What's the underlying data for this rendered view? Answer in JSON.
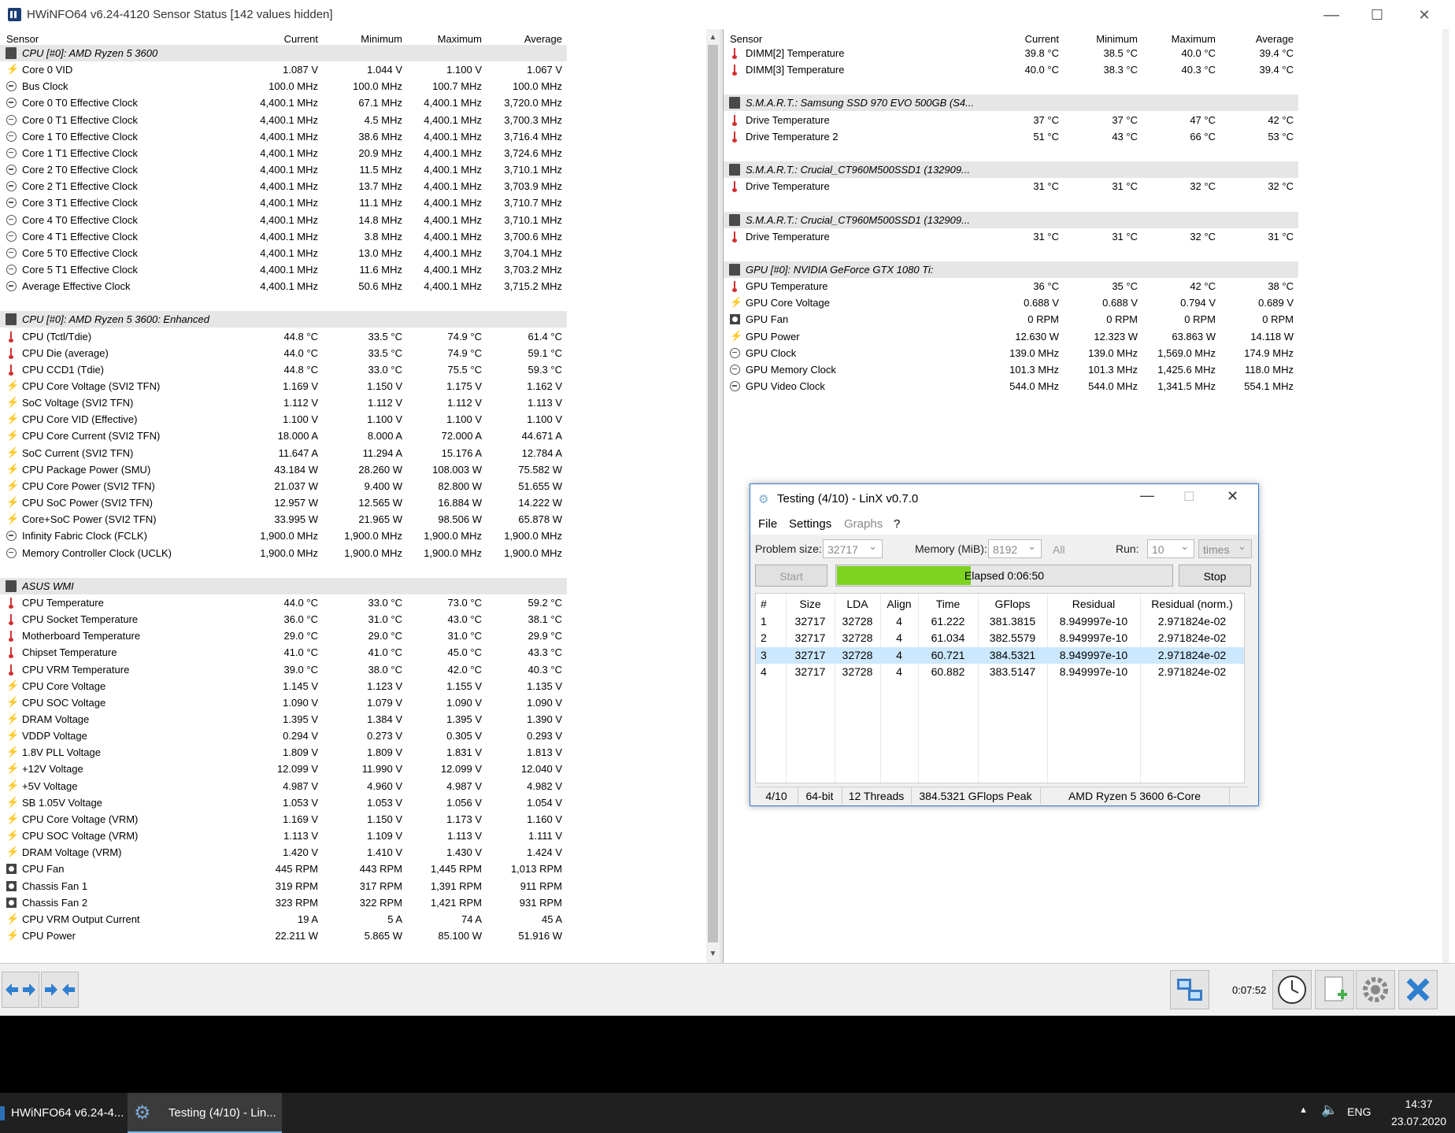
{
  "window": {
    "title": "HWiNFO64 v6.24-4120 Sensor Status [142 values hidden]",
    "min_glyph": "—",
    "max_glyph": "☐",
    "close_glyph": "✕"
  },
  "columns": {
    "sensor": "Sensor",
    "current": "Current",
    "minimum": "Minimum",
    "maximum": "Maximum",
    "average": "Average"
  },
  "left_rows": [
    {
      "type": "group",
      "label": "CPU [#0]: AMD Ryzen 5 3600"
    },
    {
      "type": "row",
      "icon": "volt",
      "label": "Core 0 VID",
      "cur": "1.087 V",
      "min": "1.044 V",
      "max": "1.100 V",
      "avg": "1.067 V"
    },
    {
      "type": "row",
      "icon": "clock",
      "label": "Bus Clock",
      "cur": "100.0 MHz",
      "min": "100.0 MHz",
      "max": "100.7 MHz",
      "avg": "100.0 MHz"
    },
    {
      "type": "row",
      "icon": "clock",
      "label": "Core 0 T0 Effective Clock",
      "cur": "4,400.1 MHz",
      "min": "67.1 MHz",
      "max": "4,400.1 MHz",
      "avg": "3,720.0 MHz"
    },
    {
      "type": "row",
      "icon": "clock",
      "label": "Core 0 T1 Effective Clock",
      "cur": "4,400.1 MHz",
      "min": "4.5 MHz",
      "max": "4,400.1 MHz",
      "avg": "3,700.3 MHz"
    },
    {
      "type": "row",
      "icon": "clock",
      "label": "Core 1 T0 Effective Clock",
      "cur": "4,400.1 MHz",
      "min": "38.6 MHz",
      "max": "4,400.1 MHz",
      "avg": "3,716.4 MHz"
    },
    {
      "type": "row",
      "icon": "clock",
      "label": "Core 1 T1 Effective Clock",
      "cur": "4,400.1 MHz",
      "min": "20.9 MHz",
      "max": "4,400.1 MHz",
      "avg": "3,724.6 MHz"
    },
    {
      "type": "row",
      "icon": "clock",
      "label": "Core 2 T0 Effective Clock",
      "cur": "4,400.1 MHz",
      "min": "11.5 MHz",
      "max": "4,400.1 MHz",
      "avg": "3,710.1 MHz"
    },
    {
      "type": "row",
      "icon": "clock",
      "label": "Core 2 T1 Effective Clock",
      "cur": "4,400.1 MHz",
      "min": "13.7 MHz",
      "max": "4,400.1 MHz",
      "avg": "3,703.9 MHz"
    },
    {
      "type": "row",
      "icon": "clock",
      "label": "Core 3 T1 Effective Clock",
      "cur": "4,400.1 MHz",
      "min": "11.1 MHz",
      "max": "4,400.1 MHz",
      "avg": "3,710.7 MHz"
    },
    {
      "type": "row",
      "icon": "clock",
      "label": "Core 4 T0 Effective Clock",
      "cur": "4,400.1 MHz",
      "min": "14.8 MHz",
      "max": "4,400.1 MHz",
      "avg": "3,710.1 MHz"
    },
    {
      "type": "row",
      "icon": "clock",
      "label": "Core 4 T1 Effective Clock",
      "cur": "4,400.1 MHz",
      "min": "3.8 MHz",
      "max": "4,400.1 MHz",
      "avg": "3,700.6 MHz"
    },
    {
      "type": "row",
      "icon": "clock",
      "label": "Core 5 T0 Effective Clock",
      "cur": "4,400.1 MHz",
      "min": "13.0 MHz",
      "max": "4,400.1 MHz",
      "avg": "3,704.1 MHz"
    },
    {
      "type": "row",
      "icon": "clock",
      "label": "Core 5 T1 Effective Clock",
      "cur": "4,400.1 MHz",
      "min": "11.6 MHz",
      "max": "4,400.1 MHz",
      "avg": "3,703.2 MHz"
    },
    {
      "type": "row",
      "icon": "clock",
      "label": "Average Effective Clock",
      "cur": "4,400.1 MHz",
      "min": "50.6 MHz",
      "max": "4,400.1 MHz",
      "avg": "3,715.2 MHz"
    },
    {
      "type": "blank"
    },
    {
      "type": "group",
      "label": "CPU [#0]: AMD Ryzen 5 3600: Enhanced"
    },
    {
      "type": "row",
      "icon": "temp",
      "label": "CPU (Tctl/Tdie)",
      "cur": "44.8 °C",
      "min": "33.5 °C",
      "max": "74.9 °C",
      "avg": "61.4 °C"
    },
    {
      "type": "row",
      "icon": "temp",
      "label": "CPU Die (average)",
      "cur": "44.0 °C",
      "min": "33.5 °C",
      "max": "74.9 °C",
      "avg": "59.1 °C"
    },
    {
      "type": "row",
      "icon": "temp",
      "label": "CPU CCD1 (Tdie)",
      "cur": "44.8 °C",
      "min": "33.0 °C",
      "max": "75.5 °C",
      "avg": "59.3 °C"
    },
    {
      "type": "row",
      "icon": "volt",
      "label": "CPU Core Voltage (SVI2 TFN)",
      "cur": "1.169 V",
      "min": "1.150 V",
      "max": "1.175 V",
      "avg": "1.162 V"
    },
    {
      "type": "row",
      "icon": "volt",
      "label": "SoC Voltage (SVI2 TFN)",
      "cur": "1.112 V",
      "min": "1.112 V",
      "max": "1.112 V",
      "avg": "1.113 V"
    },
    {
      "type": "row",
      "icon": "volt",
      "label": "CPU Core VID (Effective)",
      "cur": "1.100 V",
      "min": "1.100 V",
      "max": "1.100 V",
      "avg": "1.100 V"
    },
    {
      "type": "row",
      "icon": "volt",
      "label": "CPU Core Current (SVI2 TFN)",
      "cur": "18.000 A",
      "min": "8.000 A",
      "max": "72.000 A",
      "avg": "44.671 A"
    },
    {
      "type": "row",
      "icon": "volt",
      "label": "SoC Current (SVI2 TFN)",
      "cur": "11.647 A",
      "min": "11.294 A",
      "max": "15.176 A",
      "avg": "12.784 A"
    },
    {
      "type": "row",
      "icon": "volt",
      "label": "CPU Package Power (SMU)",
      "cur": "43.184 W",
      "min": "28.260 W",
      "max": "108.003 W",
      "avg": "75.582 W"
    },
    {
      "type": "row",
      "icon": "volt",
      "label": "CPU Core Power (SVI2 TFN)",
      "cur": "21.037 W",
      "min": "9.400 W",
      "max": "82.800 W",
      "avg": "51.655 W"
    },
    {
      "type": "row",
      "icon": "volt",
      "label": "CPU SoC Power (SVI2 TFN)",
      "cur": "12.957 W",
      "min": "12.565 W",
      "max": "16.884 W",
      "avg": "14.222 W"
    },
    {
      "type": "row",
      "icon": "volt",
      "label": "Core+SoC Power (SVI2 TFN)",
      "cur": "33.995 W",
      "min": "21.965 W",
      "max": "98.506 W",
      "avg": "65.878 W"
    },
    {
      "type": "row",
      "icon": "clock",
      "label": "Infinity Fabric Clock (FCLK)",
      "cur": "1,900.0 MHz",
      "min": "1,900.0 MHz",
      "max": "1,900.0 MHz",
      "avg": "1,900.0 MHz"
    },
    {
      "type": "row",
      "icon": "clock",
      "label": "Memory Controller Clock (UCLK)",
      "cur": "1,900.0 MHz",
      "min": "1,900.0 MHz",
      "max": "1,900.0 MHz",
      "avg": "1,900.0 MHz"
    },
    {
      "type": "blank"
    },
    {
      "type": "group",
      "label": "ASUS WMI"
    },
    {
      "type": "row",
      "icon": "temp",
      "label": "CPU Temperature",
      "cur": "44.0 °C",
      "min": "33.0 °C",
      "max": "73.0 °C",
      "avg": "59.2 °C"
    },
    {
      "type": "row",
      "icon": "temp",
      "label": "CPU Socket Temperature",
      "cur": "36.0 °C",
      "min": "31.0 °C",
      "max": "43.0 °C",
      "avg": "38.1 °C"
    },
    {
      "type": "row",
      "icon": "temp",
      "label": "Motherboard Temperature",
      "cur": "29.0 °C",
      "min": "29.0 °C",
      "max": "31.0 °C",
      "avg": "29.9 °C"
    },
    {
      "type": "row",
      "icon": "temp",
      "label": "Chipset Temperature",
      "cur": "41.0 °C",
      "min": "41.0 °C",
      "max": "45.0 °C",
      "avg": "43.3 °C"
    },
    {
      "type": "row",
      "icon": "temp",
      "label": "CPU VRM Temperature",
      "cur": "39.0 °C",
      "min": "38.0 °C",
      "max": "42.0 °C",
      "avg": "40.3 °C"
    },
    {
      "type": "row",
      "icon": "volt",
      "label": "CPU Core Voltage",
      "cur": "1.145 V",
      "min": "1.123 V",
      "max": "1.155 V",
      "avg": "1.135 V"
    },
    {
      "type": "row",
      "icon": "volt",
      "label": "CPU SOC Voltage",
      "cur": "1.090 V",
      "min": "1.079 V",
      "max": "1.090 V",
      "avg": "1.090 V"
    },
    {
      "type": "row",
      "icon": "volt",
      "label": "DRAM Voltage",
      "cur": "1.395 V",
      "min": "1.384 V",
      "max": "1.395 V",
      "avg": "1.390 V"
    },
    {
      "type": "row",
      "icon": "volt",
      "label": "VDDP Voltage",
      "cur": "0.294 V",
      "min": "0.273 V",
      "max": "0.305 V",
      "avg": "0.293 V"
    },
    {
      "type": "row",
      "icon": "volt",
      "label": "1.8V PLL Voltage",
      "cur": "1.809 V",
      "min": "1.809 V",
      "max": "1.831 V",
      "avg": "1.813 V"
    },
    {
      "type": "row",
      "icon": "volt",
      "label": "+12V Voltage",
      "cur": "12.099 V",
      "min": "11.990 V",
      "max": "12.099 V",
      "avg": "12.040 V"
    },
    {
      "type": "row",
      "icon": "volt",
      "label": "+5V Voltage",
      "cur": "4.987 V",
      "min": "4.960 V",
      "max": "4.987 V",
      "avg": "4.982 V"
    },
    {
      "type": "row",
      "icon": "volt",
      "label": "SB 1.05V Voltage",
      "cur": "1.053 V",
      "min": "1.053 V",
      "max": "1.056 V",
      "avg": "1.054 V"
    },
    {
      "type": "row",
      "icon": "volt",
      "label": "CPU Core Voltage (VRM)",
      "cur": "1.169 V",
      "min": "1.150 V",
      "max": "1.173 V",
      "avg": "1.160 V"
    },
    {
      "type": "row",
      "icon": "volt",
      "label": "CPU SOC Voltage (VRM)",
      "cur": "1.113 V",
      "min": "1.109 V",
      "max": "1.113 V",
      "avg": "1.111 V"
    },
    {
      "type": "row",
      "icon": "volt",
      "label": "DRAM Voltage (VRM)",
      "cur": "1.420 V",
      "min": "1.410 V",
      "max": "1.430 V",
      "avg": "1.424 V"
    },
    {
      "type": "row",
      "icon": "fan",
      "label": "CPU Fan",
      "cur": "445 RPM",
      "min": "443 RPM",
      "max": "1,445 RPM",
      "avg": "1,013 RPM"
    },
    {
      "type": "row",
      "icon": "fan",
      "label": "Chassis Fan 1",
      "cur": "319 RPM",
      "min": "317 RPM",
      "max": "1,391 RPM",
      "avg": "911 RPM"
    },
    {
      "type": "row",
      "icon": "fan",
      "label": "Chassis Fan 2",
      "cur": "323 RPM",
      "min": "322 RPM",
      "max": "1,421 RPM",
      "avg": "931 RPM"
    },
    {
      "type": "row",
      "icon": "volt",
      "label": "CPU VRM Output Current",
      "cur": "19 A",
      "min": "5 A",
      "max": "74 A",
      "avg": "45 A"
    },
    {
      "type": "row",
      "icon": "volt",
      "label": "CPU Power",
      "cur": "22.211 W",
      "min": "5.865 W",
      "max": "85.100 W",
      "avg": "51.916 W"
    }
  ],
  "right_rows": [
    {
      "type": "row",
      "icon": "temp",
      "label": "DIMM[2] Temperature",
      "cur": "39.8 °C",
      "min": "38.5 °C",
      "max": "40.0 °C",
      "avg": "39.4 °C"
    },
    {
      "type": "row",
      "icon": "temp",
      "label": "DIMM[3] Temperature",
      "cur": "40.0 °C",
      "min": "38.3 °C",
      "max": "40.3 °C",
      "avg": "39.4 °C"
    },
    {
      "type": "blank"
    },
    {
      "type": "group",
      "label": "S.M.A.R.T.: Samsung SSD 970 EVO 500GB (S4..."
    },
    {
      "type": "row",
      "icon": "temp",
      "label": "Drive Temperature",
      "cur": "37 °C",
      "min": "37 °C",
      "max": "47 °C",
      "avg": "42 °C"
    },
    {
      "type": "row",
      "icon": "temp",
      "label": "Drive Temperature 2",
      "cur": "51 °C",
      "min": "43 °C",
      "max": "66 °C",
      "avg": "53 °C"
    },
    {
      "type": "blank"
    },
    {
      "type": "group",
      "label": "S.M.A.R.T.: Crucial_CT960M500SSD1 (132909..."
    },
    {
      "type": "row",
      "icon": "temp",
      "label": "Drive Temperature",
      "cur": "31 °C",
      "min": "31 °C",
      "max": "32 °C",
      "avg": "32 °C"
    },
    {
      "type": "blank"
    },
    {
      "type": "group",
      "label": "S.M.A.R.T.: Crucial_CT960M500SSD1 (132909..."
    },
    {
      "type": "row",
      "icon": "temp",
      "label": "Drive Temperature",
      "cur": "31 °C",
      "min": "31 °C",
      "max": "32 °C",
      "avg": "31 °C"
    },
    {
      "type": "blank"
    },
    {
      "type": "group",
      "label": "GPU [#0]: NVIDIA GeForce GTX 1080 Ti:"
    },
    {
      "type": "row",
      "icon": "temp",
      "label": "GPU Temperature",
      "cur": "36 °C",
      "min": "35 °C",
      "max": "42 °C",
      "avg": "38 °C"
    },
    {
      "type": "row",
      "icon": "volt",
      "label": "GPU Core Voltage",
      "cur": "0.688 V",
      "min": "0.688 V",
      "max": "0.794 V",
      "avg": "0.689 V"
    },
    {
      "type": "row",
      "icon": "fan",
      "label": "GPU Fan",
      "cur": "0 RPM",
      "min": "0 RPM",
      "max": "0 RPM",
      "avg": "0 RPM"
    },
    {
      "type": "row",
      "icon": "volt",
      "label": "GPU Power",
      "cur": "12.630 W",
      "min": "12.323 W",
      "max": "63.863 W",
      "avg": "14.118 W"
    },
    {
      "type": "row",
      "icon": "clock",
      "label": "GPU Clock",
      "cur": "139.0 MHz",
      "min": "139.0 MHz",
      "max": "1,569.0 MHz",
      "avg": "174.9 MHz"
    },
    {
      "type": "row",
      "icon": "clock",
      "label": "GPU Memory Clock",
      "cur": "101.3 MHz",
      "min": "101.3 MHz",
      "max": "1,425.6 MHz",
      "avg": "118.0 MHz"
    },
    {
      "type": "row",
      "icon": "clock",
      "label": "GPU Video Clock",
      "cur": "544.0 MHz",
      "min": "544.0 MHz",
      "max": "1,341.5 MHz",
      "avg": "554.1 MHz"
    }
  ],
  "toolbar": {
    "timer": "0:07:52"
  },
  "linx": {
    "title": "Testing (4/10) - LinX v0.7.0",
    "menu": [
      "File",
      "Settings",
      "Graphs",
      "?"
    ],
    "problem_size_label": "Problem size:",
    "problem_size": "32717",
    "memory_label": "Memory (MiB):",
    "memory": "8192",
    "all_label": "All",
    "run_label": "Run:",
    "run": "10",
    "times": "times",
    "start_label": "Start",
    "stop_label": "Stop",
    "elapsed": "Elapsed 0:06:50",
    "progress": 0.4,
    "progress_color": "#7ed321",
    "headers": [
      "#",
      "Size",
      "LDA",
      "Align",
      "Time",
      "GFlops",
      "Residual",
      "Residual (norm.)"
    ],
    "rows": [
      [
        "1",
        "32717",
        "32728",
        "4",
        "61.222",
        "381.3815",
        "8.949997e-10",
        "2.971824e-02"
      ],
      [
        "2",
        "32717",
        "32728",
        "4",
        "61.034",
        "382.5579",
        "8.949997e-10",
        "2.971824e-02"
      ],
      [
        "3",
        "32717",
        "32728",
        "4",
        "60.721",
        "384.5321",
        "8.949997e-10",
        "2.971824e-02"
      ],
      [
        "4",
        "32717",
        "32728",
        "4",
        "60.882",
        "383.5147",
        "8.949997e-10",
        "2.971824e-02"
      ]
    ],
    "selected_row": 2,
    "status": [
      "4/10",
      "64-bit",
      "12 Threads",
      "384.5321 GFlops Peak",
      "AMD Ryzen 5 3600 6-Core"
    ]
  },
  "taskbar": {
    "items": [
      "HWiNFO64 v6.24-4...",
      "Testing (4/10) - Lin..."
    ],
    "lang": "ENG",
    "time": "14:37",
    "date": "23.07.2020"
  }
}
